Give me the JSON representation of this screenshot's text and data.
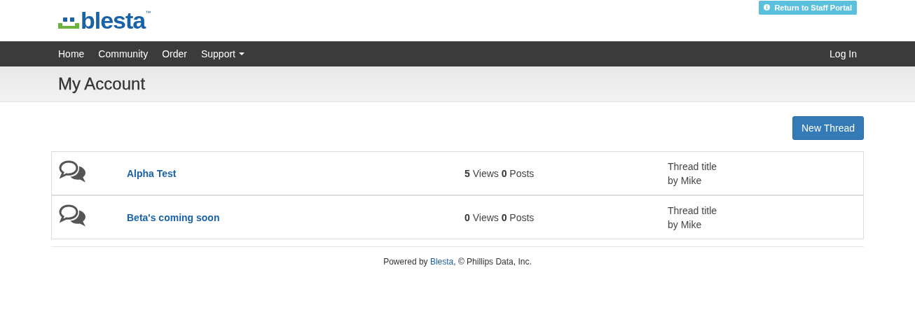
{
  "logo": {
    "text": "blesta",
    "mark": "™"
  },
  "staff_button": {
    "label": "Return to Staff Portal"
  },
  "nav": {
    "items": [
      {
        "label": "Home",
        "kind": "link"
      },
      {
        "label": "Community",
        "kind": "link"
      },
      {
        "label": "Order",
        "kind": "link"
      },
      {
        "label": "Support",
        "kind": "dropdown"
      }
    ],
    "login": "Log In"
  },
  "page_title": "My Account",
  "new_thread_button": "New Thread",
  "threads": [
    {
      "title": "Alpha Test",
      "stats": "**5** Views **0** Posts",
      "last_title": "Thread title",
      "last_author": "by Mike"
    },
    {
      "title": "Beta's coming soon",
      "stats": "**0** Views **0** Posts",
      "last_title": "Thread title",
      "last_author": "by Mike"
    }
  ],
  "footer": {
    "before": "Powered by ",
    "link": "Blesta",
    "after": ", © Phillips Data, Inc."
  }
}
